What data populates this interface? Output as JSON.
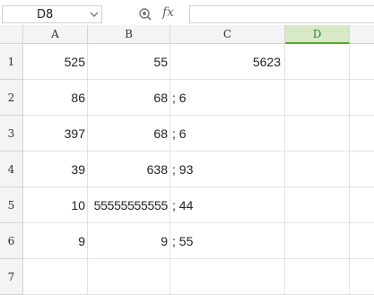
{
  "formula_bar": {
    "name_box": "D8",
    "zoom_icon": "magnifier-icon",
    "fx_label": "fx",
    "formula_value": ""
  },
  "columns": [
    "A",
    "B",
    "C",
    "D"
  ],
  "selected_column": "D",
  "rows": [
    {
      "num": "1",
      "a": "525",
      "b": "55",
      "c": "5623"
    },
    {
      "num": "2",
      "a": "86",
      "b": "68",
      "c": "; 6"
    },
    {
      "num": "3",
      "a": "397",
      "b": "68",
      "c": "; 6"
    },
    {
      "num": "4",
      "a": "39",
      "b": "638",
      "c": "; 93"
    },
    {
      "num": "5",
      "a": "10",
      "b": "55555555555",
      "c": "; 44"
    },
    {
      "num": "6",
      "a": "9",
      "b": "9",
      "c": "; 55"
    },
    {
      "num": "7",
      "a": "",
      "b": "",
      "c": ""
    }
  ]
}
